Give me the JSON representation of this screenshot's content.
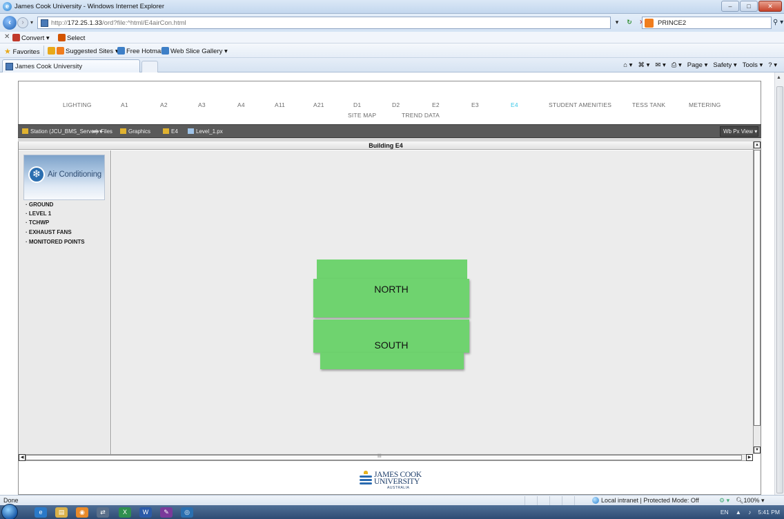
{
  "window": {
    "title": "James Cook University - Windows Internet Explorer",
    "min": "–",
    "max": "□",
    "close": "✕"
  },
  "address": {
    "url_prefix": "http://",
    "url_host": "172.25.1.33",
    "url_path": "/ord?file:^html/E4airCon.html",
    "search_text": "PRINCE2"
  },
  "commandbar": {
    "convert": "Convert ▾",
    "select": "Select"
  },
  "favorites": {
    "favorites": "Favorites",
    "suggested": "Suggested Sites ▾",
    "hotmail": "Free Hotmail",
    "webslice": "Web Slice Gallery ▾"
  },
  "tabs": {
    "active": "James Cook University",
    "tools": [
      "Page ▾",
      "Safety ▾",
      "Tools ▾"
    ]
  },
  "topnav": {
    "items": [
      "LIGHTING",
      "A1",
      "A2",
      "A3",
      "A4",
      "A11",
      "A21",
      "D1",
      "D2",
      "E2",
      "E3",
      "E4",
      "STUDENT AMENITIES",
      "TESS TANK",
      "METERING"
    ],
    "sub": [
      "SITE MAP",
      "TREND DATA"
    ],
    "active": "E4"
  },
  "breadcrumb": {
    "station": "Station (JCU_BMS_Server) ▾",
    "files": "Files",
    "graphics": "Graphics",
    "e4": "E4",
    "file": "Level_1.px",
    "view": "Wb Px View ▾"
  },
  "page": {
    "building_title": "Building E4",
    "badge_label": "Air Conditioning",
    "side_links": [
      "· GROUND",
      "· LEVEL 1",
      "· TCHWP",
      "· EXHAUST FANS",
      "· MONITORED POINTS"
    ],
    "zones": [
      "NORTH",
      "SOUTH"
    ]
  },
  "footer": {
    "logo_line1": "JAMES COOK",
    "logo_line2": "UNIVERSITY",
    "logo_line3": "AUSTRALIA"
  },
  "status": {
    "left": "Done",
    "zone": "Local intranet | Protected Mode: Off",
    "zoom": "100% ▾"
  },
  "taskbar": {
    "lang": "EN",
    "time": "5:41 PM"
  },
  "colors": {
    "zone_fill": "#6fd36f",
    "nav_active": "#38c7e8",
    "crumb_bar": "#5a5a5a"
  }
}
